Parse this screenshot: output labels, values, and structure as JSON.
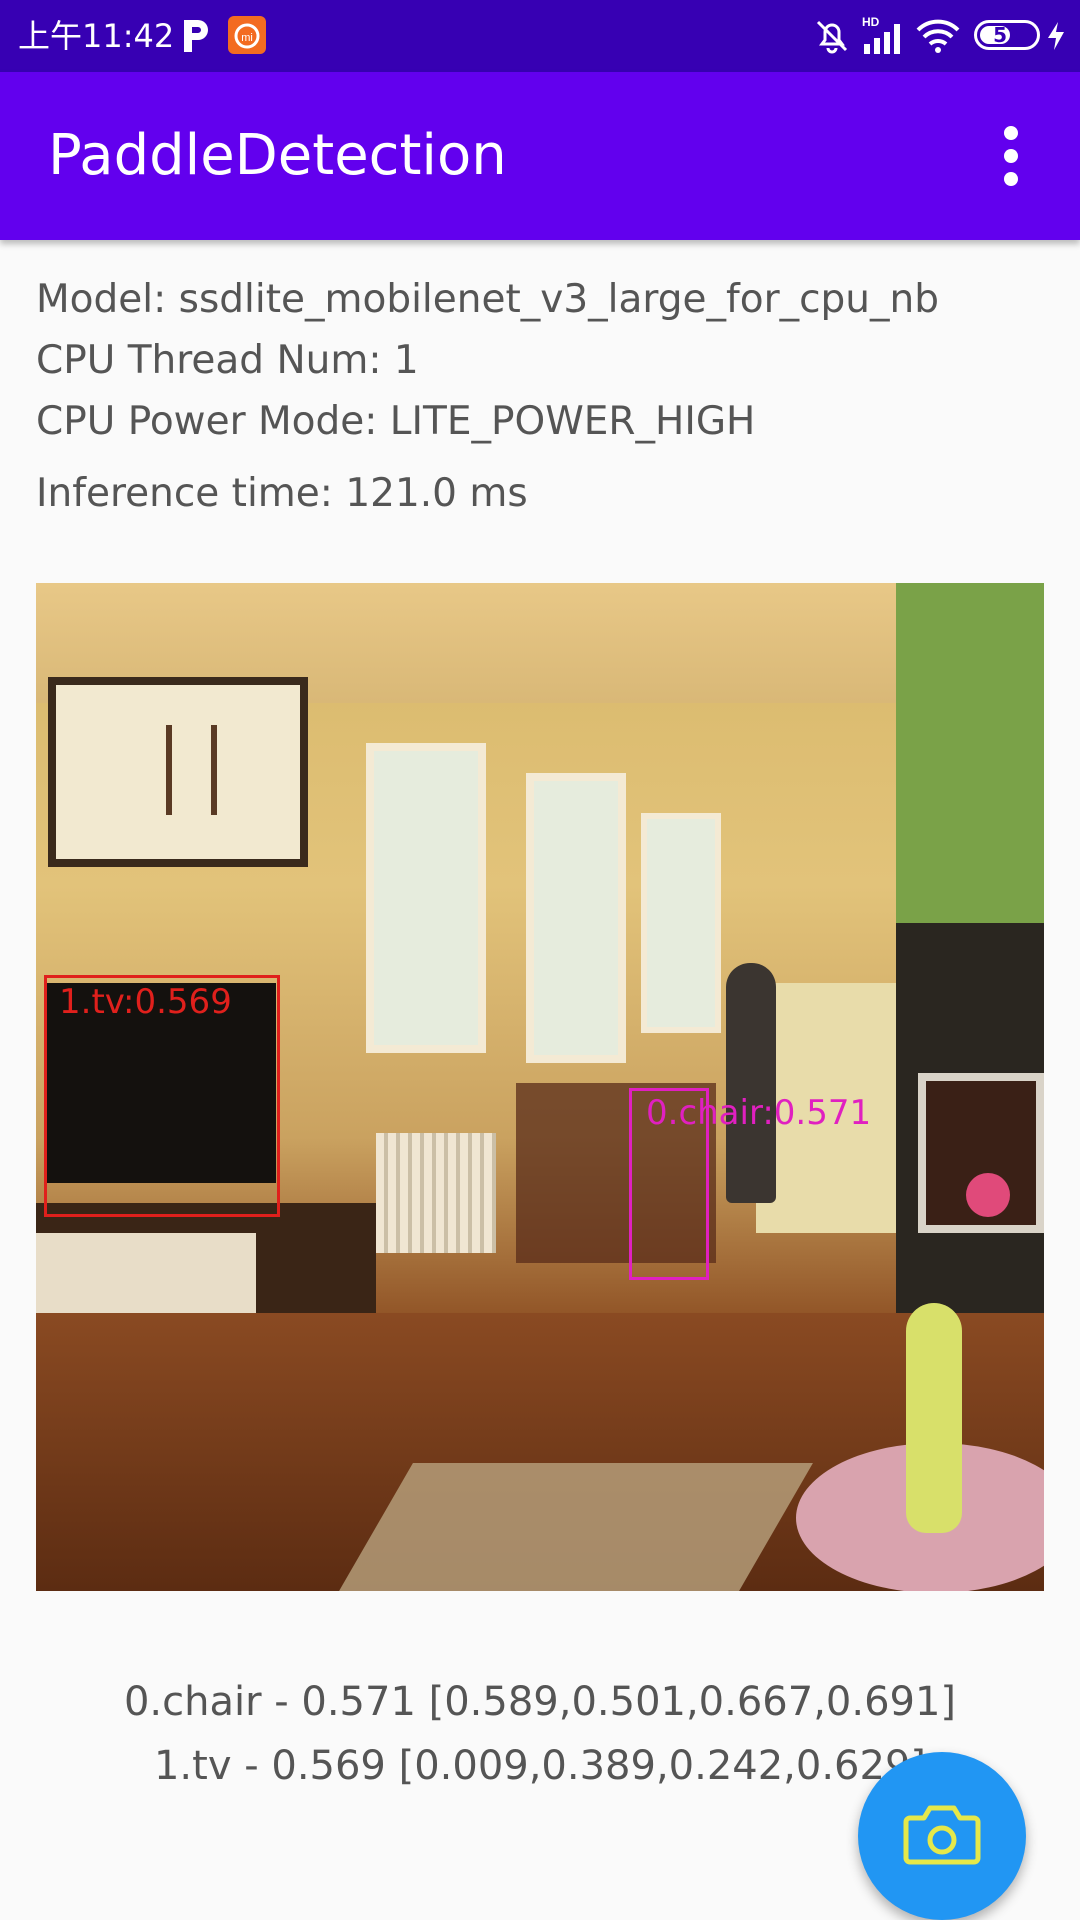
{
  "status_bar": {
    "time": "上午11:42",
    "battery": "51",
    "icons": [
      "parking-icon",
      "mi-store-icon",
      "bell-off-icon",
      "signal-hd-icon",
      "wifi-icon",
      "battery-icon",
      "charging-icon"
    ]
  },
  "app_bar": {
    "title": "PaddleDetection",
    "overflow_icon": "more-vert-icon"
  },
  "info": {
    "model": "Model: ssdlite_mobilenet_v3_large_for_cpu_nb",
    "threads": "CPU Thread Num: 1",
    "power_mode": "CPU Power Mode: LITE_POWER_HIGH",
    "inference_time": "Inference time: 121.0 ms"
  },
  "detections": [
    {
      "label": "1.tv:0.569",
      "color": "#e0201c"
    },
    {
      "label": "0.chair:0.571",
      "color": "#e020c0"
    }
  ],
  "results": {
    "line1": "0.chair - 0.571 [0.589,0.501,0.667,0.691]",
    "line2": "1.tv - 0.569 [0.009,0.389,0.242,0.629]"
  },
  "fab": {
    "icon": "camera-icon",
    "color": "#2196f3"
  }
}
